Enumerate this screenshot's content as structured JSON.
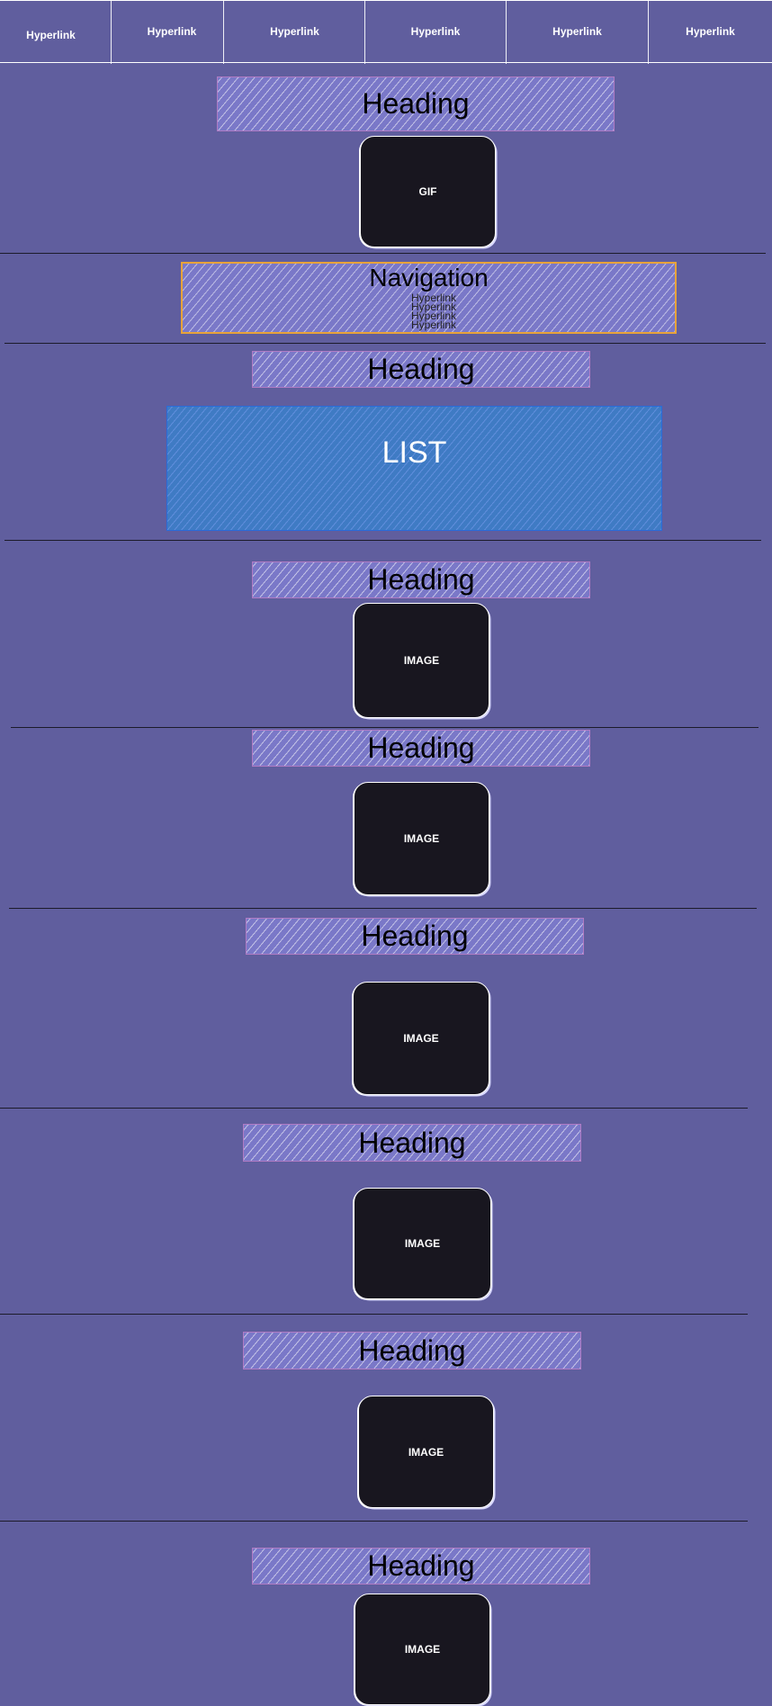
{
  "top_nav": {
    "items": [
      {
        "label": "Hyperlink"
      },
      {
        "label": "Hyperlink"
      },
      {
        "label": "Hyperlink"
      },
      {
        "label": "Hyperlink"
      },
      {
        "label": "Hyperlink"
      },
      {
        "label": "Hyperlink"
      }
    ]
  },
  "gif_section": {
    "heading": "Heading",
    "media_label": "GIF"
  },
  "navigation_section": {
    "title": "Navigation",
    "links": [
      "Hyperlink",
      "Hyperlink",
      "Hyperlink",
      "Hyperlink"
    ]
  },
  "list_section": {
    "heading": "Heading",
    "list_label": "LIST"
  },
  "image_sections": [
    {
      "heading": "Heading",
      "media_label": "IMAGE"
    },
    {
      "heading": "Heading",
      "media_label": "IMAGE"
    },
    {
      "heading": "Heading",
      "media_label": "IMAGE"
    },
    {
      "heading": "Heading",
      "media_label": "IMAGE"
    },
    {
      "heading": "Heading",
      "media_label": "IMAGE"
    },
    {
      "heading": "Heading",
      "media_label": "IMAGE"
    }
  ],
  "colors": {
    "background": "#605e9e",
    "hatch_fill": "#7a78c8",
    "media_fill": "#18161f",
    "nav_border": "#e8a33a",
    "list_fill": "#3f7bc4"
  }
}
